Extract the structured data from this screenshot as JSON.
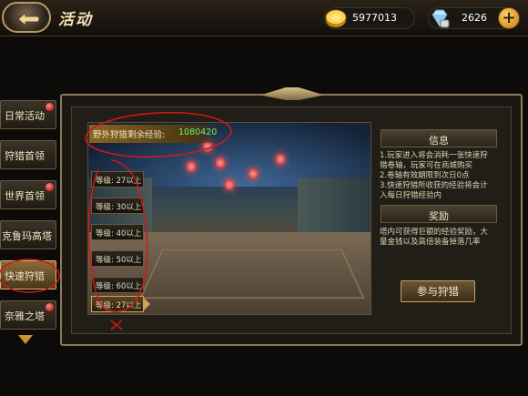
{
  "header": {
    "title": "活动",
    "gold": "5977013",
    "diamonds": "2626",
    "add_label": "+"
  },
  "tabs": [
    {
      "label": "日常活动",
      "badge": true,
      "active": false
    },
    {
      "label": "狩猎首领",
      "badge": false,
      "active": false
    },
    {
      "label": "世界首领",
      "badge": true,
      "active": false
    },
    {
      "label": "克鲁玛高塔",
      "badge": false,
      "active": false
    },
    {
      "label": "快速狩猎",
      "badge": false,
      "active": true
    },
    {
      "label": "奈雅之塔",
      "badge": true,
      "active": false
    }
  ],
  "hunt": {
    "exp_label": "野外狩猎剩余经验:",
    "exp_value": "1080420",
    "levels": [
      "等级: 27以上",
      "等级: 30以上",
      "等级: 40以上",
      "等级: 50以上",
      "等级: 60以上",
      "等级: 27以上"
    ],
    "selected_level_index": 5
  },
  "info": {
    "title": "信息",
    "lines": [
      "1.玩家进入将会消耗一张快速狩",
      "猎卷轴，玩家可在商城购买",
      "2.卷轴有效期限到次日0点",
      "3.快速狩猎所收获的经验将会计",
      "入每日狩猎经验内"
    ]
  },
  "reward": {
    "title": "奖励",
    "lines": [
      "塔内可获得巨额的经验奖励，大",
      "量金钱以及高倍装备掉落几率"
    ]
  },
  "join_label": "参与狩猎",
  "colors": {
    "accent_gold": "#c9a45c",
    "exp_green": "#6cf070",
    "annotation_red": "#d01818"
  }
}
